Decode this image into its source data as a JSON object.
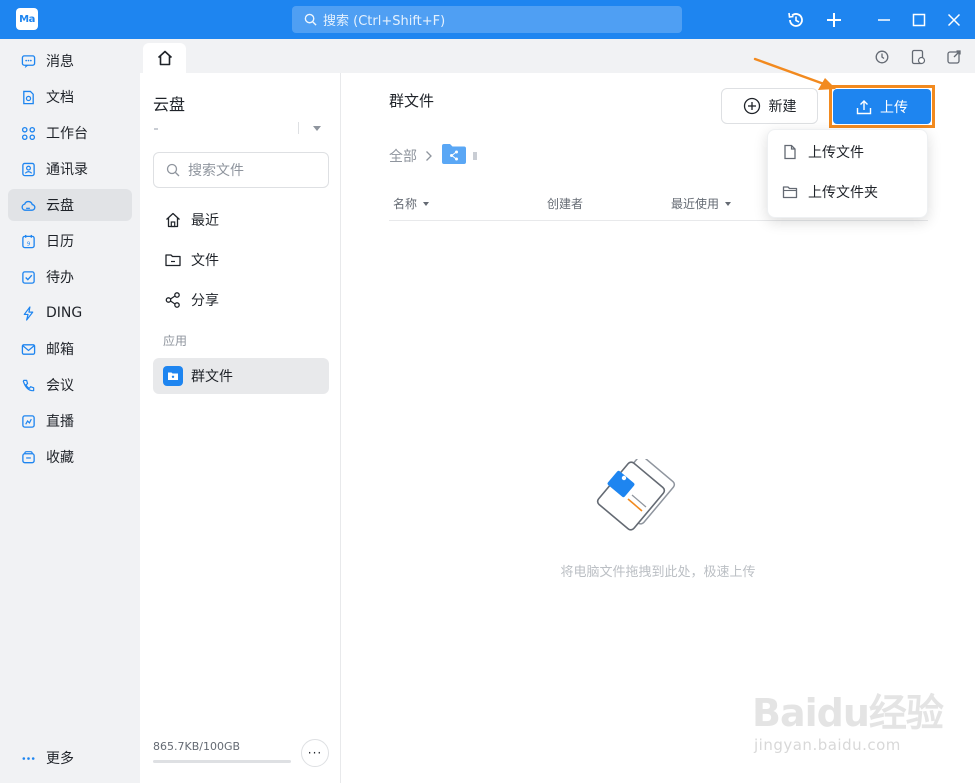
{
  "app": {
    "logo_text": "Ma"
  },
  "titlebar": {
    "search_placeholder": "搜索 (Ctrl+Shift+F)",
    "icons": [
      "history-icon",
      "plus-icon",
      "minimize-icon",
      "maximize-icon",
      "close-icon"
    ]
  },
  "leftnav": {
    "items": [
      {
        "label": "消息",
        "icon": "message-icon"
      },
      {
        "label": "文档",
        "icon": "document-icon"
      },
      {
        "label": "工作台",
        "icon": "workbench-icon"
      },
      {
        "label": "通讯录",
        "icon": "contacts-icon"
      },
      {
        "label": "云盘",
        "icon": "cloud-icon",
        "active": true
      },
      {
        "label": "日历",
        "icon": "calendar-icon"
      },
      {
        "label": "待办",
        "icon": "todo-icon"
      },
      {
        "label": "DING",
        "icon": "ding-icon"
      },
      {
        "label": "邮箱",
        "icon": "mail-icon"
      },
      {
        "label": "会议",
        "icon": "meeting-icon"
      },
      {
        "label": "直播",
        "icon": "live-icon"
      },
      {
        "label": "收藏",
        "icon": "favorite-icon"
      }
    ],
    "more_label": "更多"
  },
  "midcol": {
    "title": "云盘",
    "search_placeholder": "搜索文件",
    "items": [
      {
        "label": "最近",
        "icon": "home-icon"
      },
      {
        "label": "文件",
        "icon": "folder-icon"
      },
      {
        "label": "分享",
        "icon": "share-icon"
      }
    ],
    "section_label": "应用",
    "app_item": {
      "label": "群文件",
      "icon": "group-files-icon"
    },
    "storage_text": "865.7KB/100GB",
    "storage_fraction": 8.7e-06
  },
  "main": {
    "title": "群文件",
    "new_button": "新建",
    "upload_button": "上传",
    "breadcrumb_root": "全部",
    "columns": [
      {
        "label": "名称",
        "sortable": true
      },
      {
        "label": "创建者",
        "sortable": false
      },
      {
        "label": "最近使用",
        "sortable": true
      }
    ],
    "empty_text": "将电脑文件拖拽到此处，极速上传"
  },
  "dropdown": {
    "items": [
      {
        "label": "上传文件",
        "icon": "file-icon"
      },
      {
        "label": "上传文件夹",
        "icon": "folder-icon"
      }
    ]
  },
  "colors": {
    "accent": "#1e85f0",
    "highlight": "#f28a1f"
  },
  "watermark": {
    "brand": "Baidu经验",
    "site": "jingyan.baidu.com"
  }
}
